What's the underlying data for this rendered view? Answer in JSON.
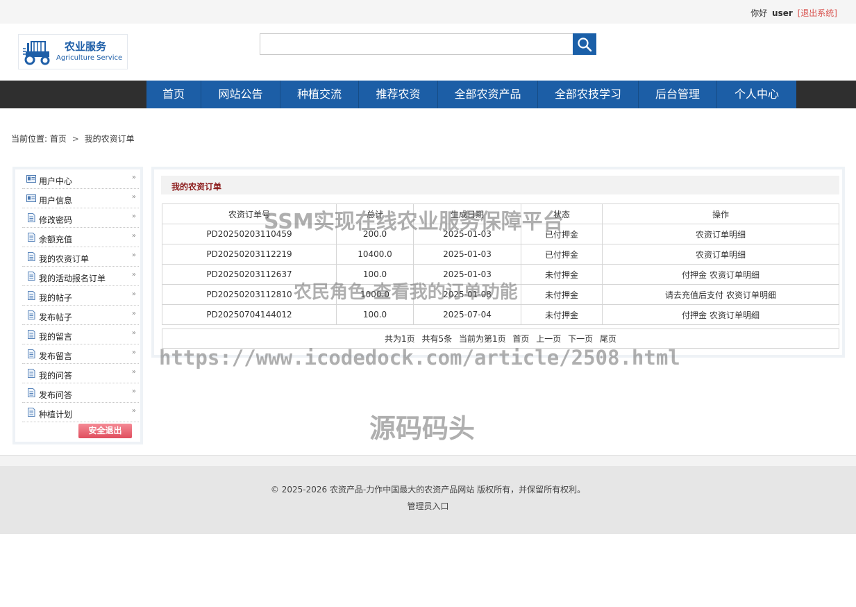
{
  "topbar": {
    "greeting": "你好",
    "username": "user",
    "logout": "[退出系统]"
  },
  "logo": {
    "title_cn": "农业服务",
    "title_en": "Agriculture Service",
    "icon": "tractor-icon"
  },
  "search": {
    "placeholder": "",
    "icon": "search-icon",
    "button_color": "#1a5fa8"
  },
  "nav": {
    "items": [
      {
        "label": "首页"
      },
      {
        "label": "网站公告"
      },
      {
        "label": "种植交流"
      },
      {
        "label": "推荐农资"
      },
      {
        "label": "全部农资产品"
      },
      {
        "label": "全部农技学习"
      },
      {
        "label": "后台管理"
      },
      {
        "label": "个人中心"
      }
    ],
    "bg_color": "#1c5ea6"
  },
  "breadcrumb": {
    "prefix": "当前位置:",
    "home": "首页",
    "sep": ">",
    "current": "我的农资订单"
  },
  "sidebar": {
    "items": [
      {
        "label": "用户中心",
        "icon": "id-card-icon"
      },
      {
        "label": "用户信息",
        "icon": "id-card-icon"
      },
      {
        "label": "修改密码",
        "icon": "document-icon"
      },
      {
        "label": "余额充值",
        "icon": "document-icon"
      },
      {
        "label": "我的农资订单",
        "icon": "document-icon"
      },
      {
        "label": "我的活动报名订单",
        "icon": "document-icon"
      },
      {
        "label": "我的帖子",
        "icon": "document-icon"
      },
      {
        "label": "发布帖子",
        "icon": "document-icon"
      },
      {
        "label": "我的留言",
        "icon": "document-icon"
      },
      {
        "label": "发布留言",
        "icon": "document-icon"
      },
      {
        "label": "我的问答",
        "icon": "document-icon"
      },
      {
        "label": "发布问答",
        "icon": "document-icon"
      },
      {
        "label": "种植计划",
        "icon": "document-icon"
      }
    ],
    "exit_label": "安全退出"
  },
  "main": {
    "title": "我的农资订单",
    "columns": [
      "农资订单号",
      "总计",
      "生成日期",
      "状态",
      "操作"
    ],
    "rows": [
      {
        "order_no": "PD20250203110459",
        "total": "200.0",
        "date": "2025-01-03",
        "status": "已付押金",
        "ops": [
          "农资订单明细"
        ]
      },
      {
        "order_no": "PD20250203112219",
        "total": "10400.0",
        "date": "2025-01-03",
        "status": "已付押金",
        "ops": [
          "农资订单明细"
        ]
      },
      {
        "order_no": "PD20250203112637",
        "total": "100.0",
        "date": "2025-01-03",
        "status": "未付押金",
        "ops": [
          "付押金",
          "农资订单明细"
        ]
      },
      {
        "order_no": "PD20250203112810",
        "total": "1000.0",
        "date": "2025-01-08",
        "status": "未付押金",
        "ops": [
          "请去充值后支付",
          "农资订单明细"
        ]
      },
      {
        "order_no": "PD20250704144012",
        "total": "100.0",
        "date": "2025-07-04",
        "status": "未付押金",
        "ops": [
          "付押金",
          "农资订单明细"
        ]
      }
    ],
    "pager": {
      "total_pages": "共为1页",
      "total_items": "共有5条",
      "current": "当前为第1页",
      "first": "首页",
      "prev": "上一页",
      "next": "下一页",
      "last": "尾页"
    }
  },
  "footer": {
    "copyright": "© 2025-2026 农资产品-力作中国最大的农资产品网站 版权所有，并保留所有权利。",
    "admin_link": "管理员入口"
  },
  "watermarks": {
    "line1": "SSM实现在线农业服务保障平台",
    "line2": "农民角色-查看我的订单功能",
    "line3": "https://www.icodedock.com/article/2508.html",
    "line4": "源码码头"
  }
}
